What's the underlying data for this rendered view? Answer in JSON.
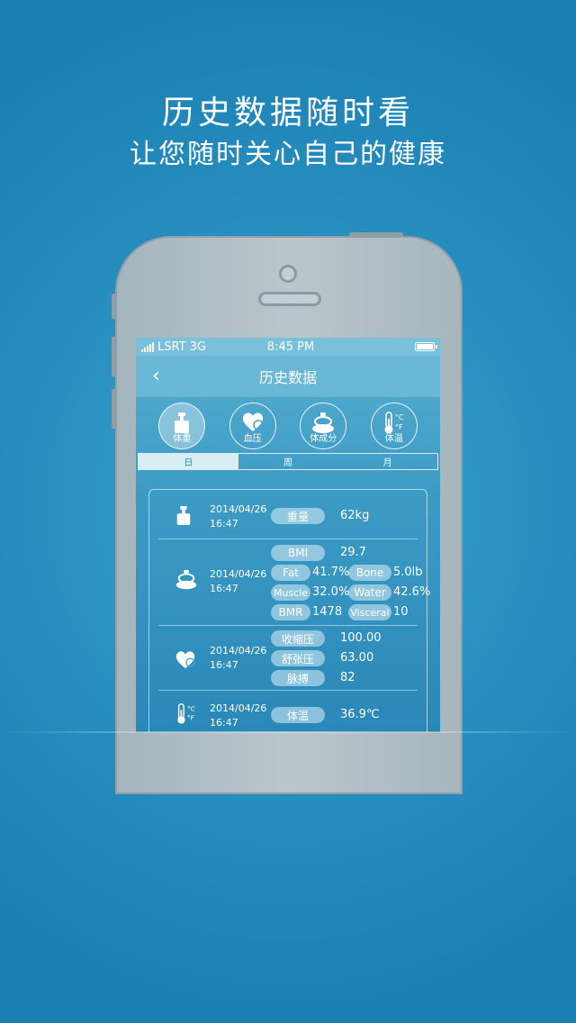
{
  "headline": {
    "title": "历史数据随时看",
    "subtitle": "让您随时关心自己的健康"
  },
  "status": {
    "carrier": "LSRT 3G",
    "time": "8:45 PM"
  },
  "nav": {
    "title": "历史数据"
  },
  "categories": [
    {
      "label": "体重",
      "icon": "scale-icon"
    },
    {
      "label": "血压",
      "icon": "heart-icon"
    },
    {
      "label": "体成分",
      "icon": "body-composition-icon"
    },
    {
      "label": "体温",
      "icon": "thermometer-icon"
    }
  ],
  "tabs": [
    "日",
    "周",
    "月"
  ],
  "records": {
    "weight": {
      "date": "2014/04/26",
      "time": "16:47",
      "label": "重量",
      "value": "62kg"
    },
    "body": {
      "date": "2014/04/26",
      "time": "16:47",
      "bmi_label": "BMI",
      "bmi": "29.7",
      "fat_label": "Fat",
      "fat": "41.7%",
      "bone_label": "Bone",
      "bone": "5.0lb",
      "muscle_label": "Muscle",
      "muscle": "32.0%",
      "water_label": "Water",
      "water": "42.6%",
      "bmr_label": "BMR",
      "bmr": "1478",
      "visceral_label": "Visceral",
      "visceral": "10"
    },
    "bp": {
      "date": "2014/04/26",
      "time": "16:47",
      "sys_label": "收缩压",
      "sys": "100.00",
      "dia_label": "舒张压",
      "dia": "63.00",
      "pulse_label": "脉搏",
      "pulse": "82"
    },
    "temp": {
      "date": "2014/04/26",
      "time": "16:47",
      "label": "体温",
      "value": "36.9℃"
    }
  }
}
